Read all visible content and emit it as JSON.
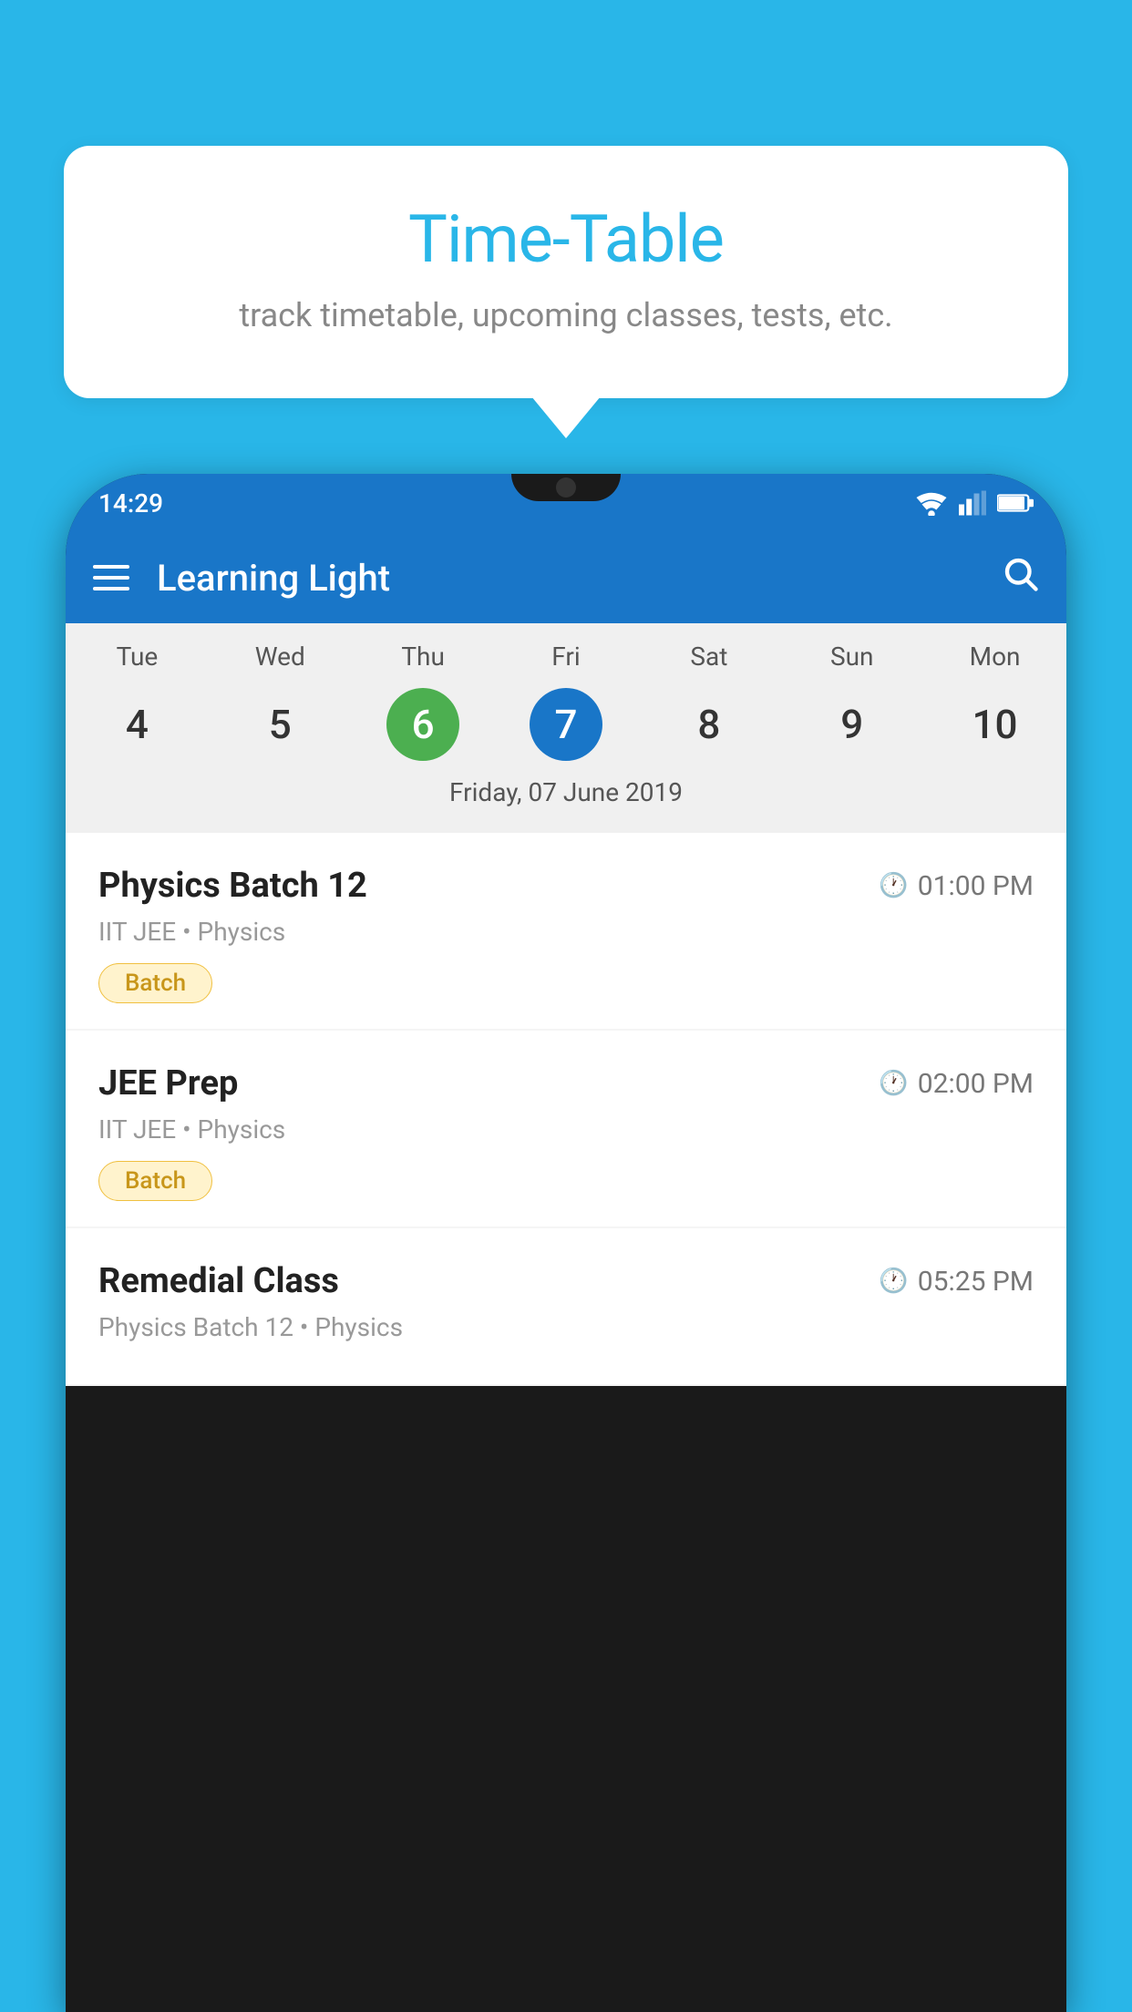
{
  "background": {
    "color": "#29b6e8"
  },
  "bubble": {
    "title": "Time-Table",
    "subtitle": "track timetable, upcoming classes, tests, etc."
  },
  "phone": {
    "status_bar": {
      "time": "14:29"
    },
    "app_bar": {
      "title": "Learning Light"
    },
    "calendar": {
      "day_headers": [
        "Tue",
        "Wed",
        "Thu",
        "Fri",
        "Sat",
        "Sun",
        "Mon"
      ],
      "day_numbers": [
        {
          "number": "4",
          "state": "normal"
        },
        {
          "number": "5",
          "state": "normal"
        },
        {
          "number": "6",
          "state": "today"
        },
        {
          "number": "7",
          "state": "selected"
        },
        {
          "number": "8",
          "state": "normal"
        },
        {
          "number": "9",
          "state": "normal"
        },
        {
          "number": "10",
          "state": "normal"
        }
      ],
      "selected_date": "Friday, 07 June 2019"
    },
    "classes": [
      {
        "name": "Physics Batch 12",
        "time": "01:00 PM",
        "meta": "IIT JEE • Physics",
        "tag": "Batch"
      },
      {
        "name": "JEE Prep",
        "time": "02:00 PM",
        "meta": "IIT JEE • Physics",
        "tag": "Batch"
      },
      {
        "name": "Remedial Class",
        "time": "05:25 PM",
        "meta": "Physics Batch 12 • Physics",
        "tag": ""
      }
    ]
  }
}
